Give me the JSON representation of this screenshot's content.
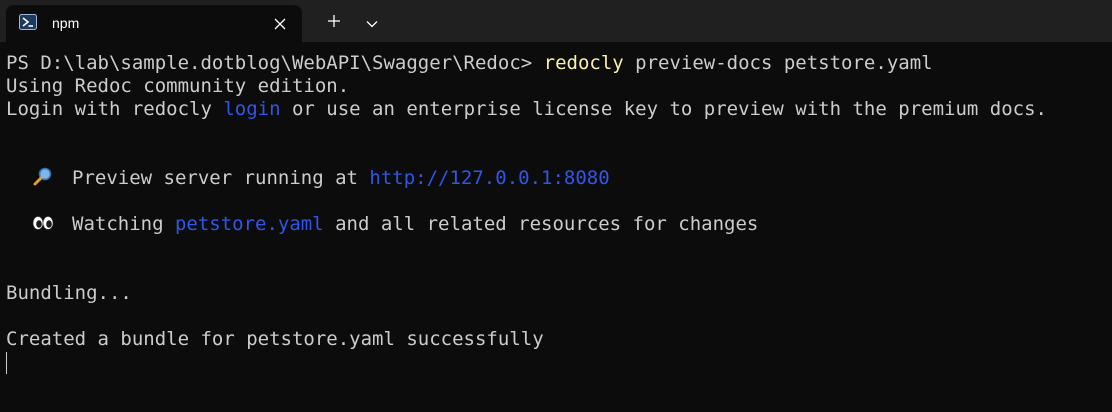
{
  "tab": {
    "title": "npm",
    "icon": "powershell-icon",
    "close_icon": "close-icon"
  },
  "toolbar": {
    "new_tab_icon": "plus-icon",
    "dropdown_icon": "chevron-down-icon"
  },
  "colors": {
    "background": "#0c0c0c",
    "tabbar": "#202020",
    "text": "#cccccc",
    "command": "#f9f1a5",
    "link": "#2f56ea"
  },
  "terminal": {
    "prompt": "PS D:\\lab\\sample.dotblog\\WebAPI\\Swagger\\Redoc> ",
    "command": "redocly",
    "command_args": " preview-docs petstore.yaml",
    "line_edition": "Using Redoc community edition.",
    "login_prefix": "Login with redocly ",
    "login_link": "login",
    "login_suffix": " or use an enterprise license key to preview with the premium docs.",
    "preview_emoji": "🔎",
    "preview_text": "Preview server running at ",
    "preview_url": "http://127.0.0.1:8080",
    "watch_emoji": "👀",
    "watch_prefix": "Watching ",
    "watch_file": "petstore.yaml",
    "watch_suffix": " and all related resources for changes",
    "bundling": "Bundling...",
    "created": "Created a bundle for petstore.yaml successfully"
  }
}
